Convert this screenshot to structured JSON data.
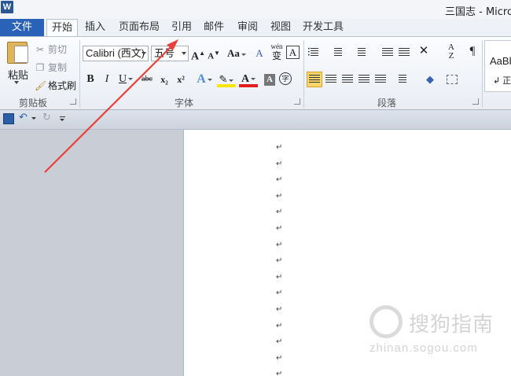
{
  "window": {
    "title": "三国志 - Microso",
    "app_logo": "W"
  },
  "tabs": [
    {
      "label": "文件"
    },
    {
      "label": "开始"
    },
    {
      "label": "插入"
    },
    {
      "label": "页面布局"
    },
    {
      "label": "引用"
    },
    {
      "label": "邮件"
    },
    {
      "label": "审阅"
    },
    {
      "label": "视图"
    },
    {
      "label": "开发工具"
    }
  ],
  "clipboard": {
    "paste": "粘贴",
    "cut": "剪切",
    "copy": "复制",
    "format_painter": "格式刷",
    "group": "剪贴板"
  },
  "font": {
    "name": "Calibri (西文)",
    "size": "五号",
    "grow": "A",
    "shrink": "A",
    "change_case": "Aa",
    "clear": "A",
    "phonetic": "wén",
    "phonetic_char": "变",
    "border_char": "A",
    "bold": "B",
    "italic": "I",
    "underline": "U",
    "strike": "abc",
    "subscript": "x₂",
    "superscript": "x²",
    "effects": "A",
    "highlight": "✎",
    "color": "A",
    "shading": "A",
    "enclose": "字",
    "group": "字体"
  },
  "paragraph": {
    "group": "段落"
  },
  "styles": {
    "preview": "AaBb",
    "preview2": "↲ 正"
  },
  "page": {
    "para_mark": "↵"
  },
  "watermark": {
    "text": "搜狗指南",
    "url": "zhinan.sogou.com"
  },
  "colors": {
    "file_tab": "#2a62b8",
    "arrow": "#e8403a",
    "highlight": "#ffe600",
    "font_color": "#e02020"
  }
}
